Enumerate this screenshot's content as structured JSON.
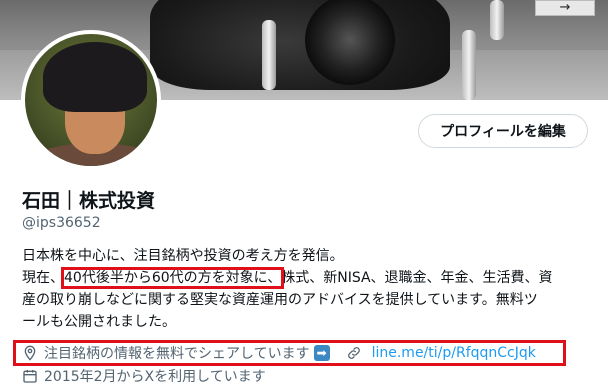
{
  "banner": {
    "sign_text": "→"
  },
  "profile": {
    "edit_button_label": "プロフィールを編集",
    "display_name": "石田｜株式投資",
    "handle": "@ips36652"
  },
  "bio": {
    "line1": "日本株を中心に、注目銘柄や投資の考え方を発信。",
    "line2_prefix": "現在、",
    "line2_highlight": "40代後半から60代の方を対象に、",
    "line2_suffix": "株式、新NISA、退職金、年金、生活費、資",
    "line3": "産の取り崩しなどに関する堅実な資産運用のアドバイスを提供しています。無料ツ",
    "line4": "ールも公開されました。"
  },
  "meta": {
    "location_text": "注目銘柄の情報を無料でシェアしています",
    "location_badge": "➡",
    "link_text": "line.me/ti/p/RfqqnCcJqk",
    "joined_text": "2015年2月からXを利用しています"
  },
  "colors": {
    "accent": "#1d9bf0",
    "highlight_border": "#e0101a",
    "muted": "#536471"
  }
}
